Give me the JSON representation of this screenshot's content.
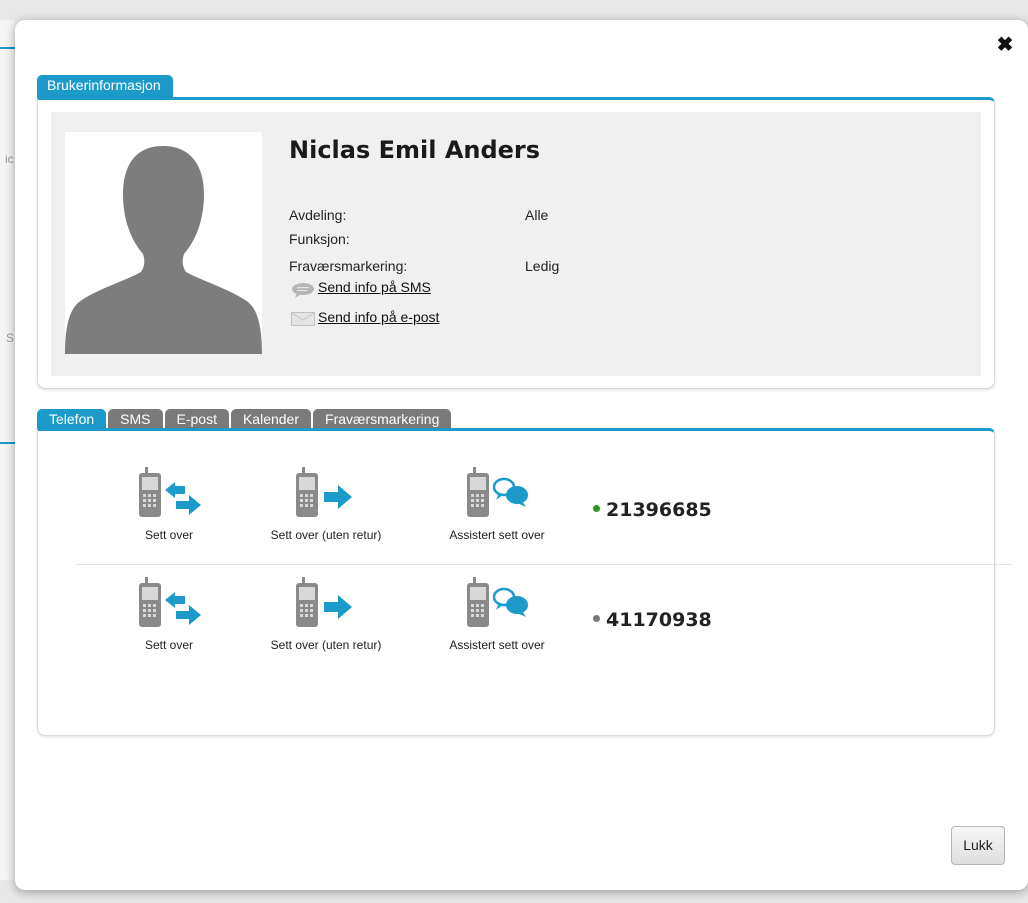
{
  "dialog": {
    "close_symbol": "✖",
    "close_button_label": "Lukk"
  },
  "user_info": {
    "tab_label": "Brukerinformasjon",
    "name": "Niclas Emil Anders",
    "fields": [
      {
        "label": "Avdeling:",
        "value": "Alle"
      },
      {
        "label": "Funksjon:",
        "value": ""
      },
      {
        "label": "Fraværsmarkering:",
        "value": "Ledig"
      }
    ],
    "send_sms_label": "Send info på SMS",
    "send_email_label": "Send info på e-post"
  },
  "tabs": [
    {
      "label": "Telefon",
      "active": true
    },
    {
      "label": "SMS",
      "active": false
    },
    {
      "label": "E-post",
      "active": false
    },
    {
      "label": "Kalender",
      "active": false
    },
    {
      "label": "Fraværsmarkering",
      "active": false
    }
  ],
  "phones": [
    {
      "number": "21396685",
      "status_color": "#2a9a1a",
      "actions": [
        "Sett over",
        "Sett over (uten retur)",
        "Assistert sett over"
      ]
    },
    {
      "number": "41170938",
      "status_color": "#777777",
      "actions": [
        "Sett over",
        "Sett over (uten retur)",
        "Assistert sett over"
      ]
    }
  ],
  "colors": {
    "accent": "#1c9ac9",
    "icon_gray": "#8a8a8a"
  },
  "background": {
    "fragments": [
      "ic",
      "S"
    ]
  }
}
